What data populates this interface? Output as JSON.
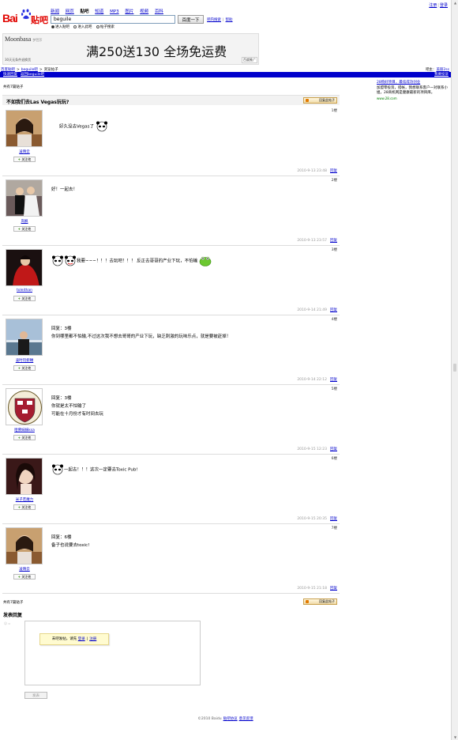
{
  "top_links": {
    "register": "注册",
    "login": "登录"
  },
  "logo": {
    "bai": "Bai",
    "tieba": "贴吧"
  },
  "nav": {
    "items": [
      {
        "label": "新闻",
        "current": false
      },
      {
        "label": "网页",
        "current": false
      },
      {
        "label": "贴吧",
        "current": true
      },
      {
        "label": "知道",
        "current": false
      },
      {
        "label": "MP3",
        "current": false
      },
      {
        "label": "图片",
        "current": false
      },
      {
        "label": "视频",
        "current": false
      },
      {
        "label": "百科",
        "current": false
      }
    ]
  },
  "search": {
    "value": "beguile",
    "button": "百度一下",
    "help1": "吧内搜索",
    "help2": "帮助",
    "radios": [
      {
        "label": "进入贴吧",
        "checked": true
      },
      {
        "label": "进入此吧",
        "checked": false
      },
      {
        "label": "帖子搜索",
        "checked": false
      }
    ]
  },
  "banner": {
    "brand": "Moonbasa",
    "brand_sub": "梦芭莎",
    "promo": "满250送130 全场免运费",
    "caption": "30天无条件退换货",
    "adtag": "百度推广"
  },
  "breadcrumb": {
    "items": [
      "百度贴吧",
      "beguile吧",
      "浏览帖子"
    ],
    "right_prefix": "吧主：",
    "right_link": "美丽2ss"
  },
  "bluebar": {
    "left": [
      "快速回复",
      "返回beguile吧"
    ],
    "right": "我要投诉"
  },
  "thread": {
    "count_top": "共有7篇贴子",
    "count_bottom": "共有7篇贴子",
    "title": "不如我们去Las Vegas玩玩?",
    "reply_btn": "回复此帖子"
  },
  "posts": [
    {
      "user": "凌晴云",
      "follow": "关注他",
      "floor": "1楼",
      "lines": [
        "好久没去Vegas了"
      ],
      "time": "2010-9-13 23:48",
      "reply": "回复"
    },
    {
      "user": "岚枫",
      "follow": "关注他",
      "floor": "2楼",
      "lines": [
        "好！一起去！"
      ],
      "time": "2010-9-13 23:57",
      "reply": "回复"
    },
    {
      "user": "toleithan",
      "follow": "关注他",
      "floor": "3楼",
      "lines": [
        "我要~~~！！！去玩吧！！！  反正去哥哥的产业下玩，不怕输"
      ],
      "time": "2010-9-14 21:49",
      "reply": "回复"
    },
    {
      "user": "凌时玩俯瞰",
      "follow": "关注他",
      "floor": "4楼",
      "lines": [
        "回复：3楼",
        "你到哪里都不怕输,不过这次我不想去哥哥的产业下玩，缺乏刺激的玩味乐点，就是要被赶掉！"
      ],
      "time": "2010-9-14 22:12",
      "reply": "回复"
    },
    {
      "user": "哈佛妹妹ksa",
      "follow": "关注他",
      "floor": "5楼",
      "lines": [
        "回复：3楼",
        "你就是太不怕输了",
        "可能在十月份才有时间去玩"
      ],
      "time": "2010-9-15 12:23",
      "reply": "回复"
    },
    {
      "user": "米子若魔力",
      "follow": "关注他",
      "floor": "6楼",
      "lines": [
        "一起去！！！这次一定要去Toxic Pub!"
      ],
      "time": "2010-9-15 20:35",
      "reply": "回复"
    },
    {
      "user": "凌晴云",
      "follow": "关注他",
      "floor": "7楼",
      "lines": [
        "回复：6楼",
        "备子也说要去toxic!"
      ],
      "time": "2010-9-15 21:18",
      "reply": "回复"
    }
  ],
  "sidebar": {
    "title": "28购好项目，最炫成功创业",
    "text": "加盟零投资，搭帐，我想联系客户一对联系小姐，28商机网是健康最新的项目库。",
    "url": "www.28.com"
  },
  "reply_form": {
    "title": "发表回复",
    "tip_prefix": "未吧发帖，请先",
    "login": "登录",
    "register": "注册",
    "submit": "发表"
  },
  "footer": {
    "copyright": "©2010 Baidu",
    "terms": "贴吧协议",
    "feedback": "意见反馈"
  },
  "colors": {
    "link": "#0000cc",
    "brand_red": "#e10602",
    "bar_blue": "#0000cc"
  }
}
